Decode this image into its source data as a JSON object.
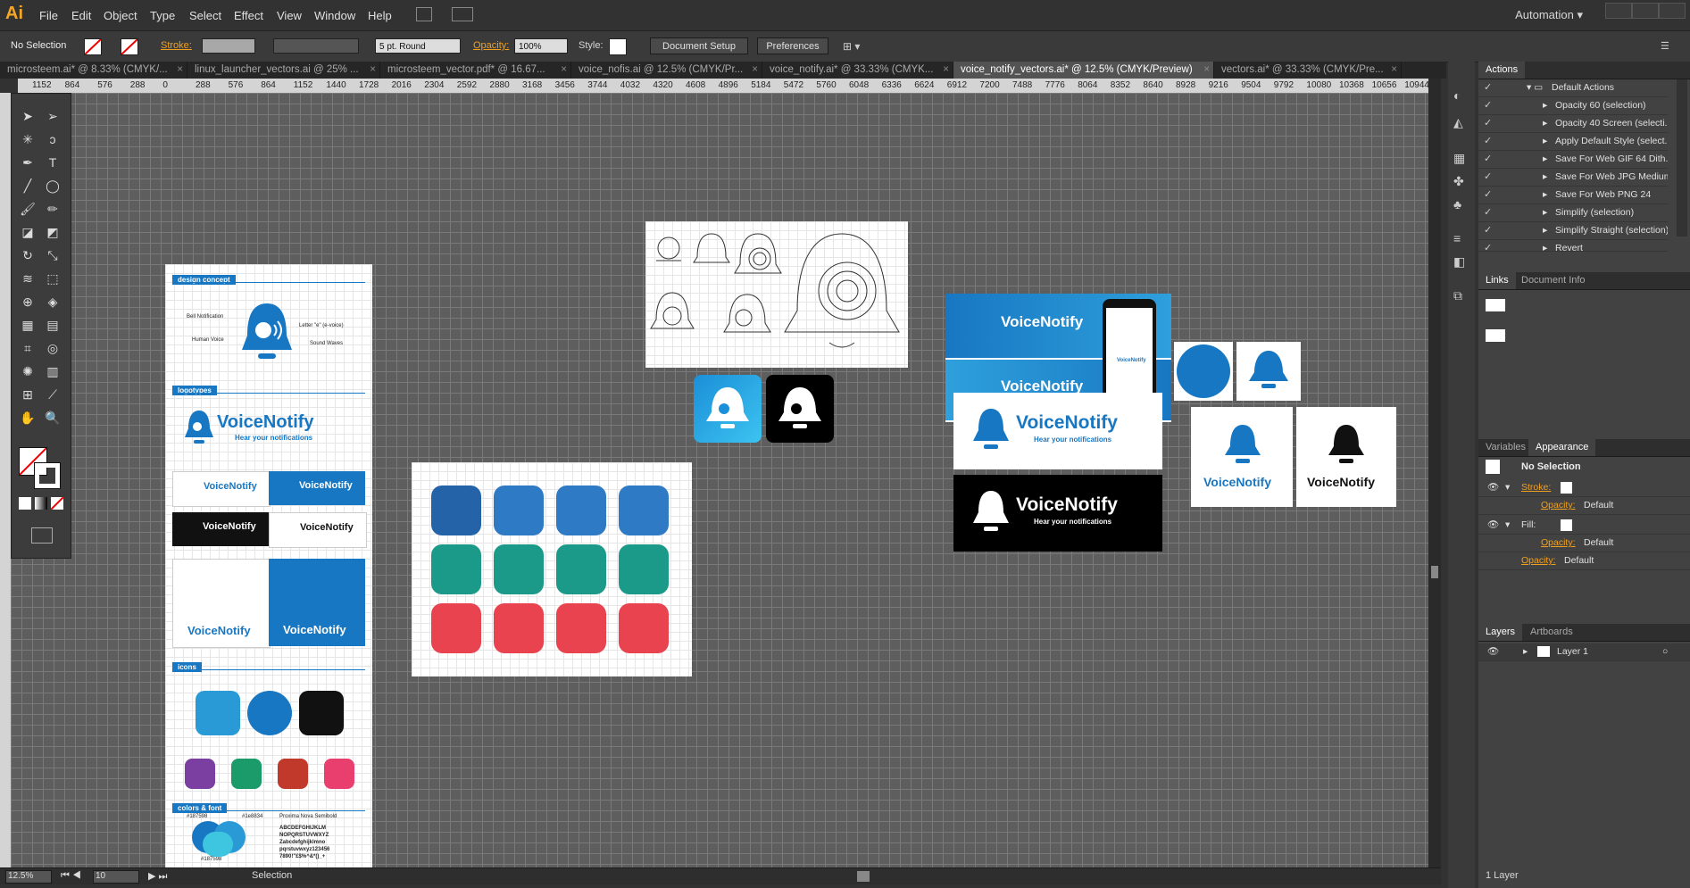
{
  "app": {
    "logo": "Ai",
    "workspace": "Automation"
  },
  "menu": [
    "File",
    "Edit",
    "Object",
    "Type",
    "Select",
    "Effect",
    "View",
    "Window",
    "Help"
  ],
  "control": {
    "selection": "No Selection",
    "stroke_label": "Stroke:",
    "brush": "5 pt. Round",
    "opacity_label": "Opacity:",
    "opacity_value": "100%",
    "style_label": "Style:",
    "doc_setup": "Document Setup",
    "preferences": "Preferences"
  },
  "tabs": [
    {
      "label": "microsteem.ai* @ 8.33% (CMYK/..."
    },
    {
      "label": "linux_launcher_vectors.ai @ 25% ..."
    },
    {
      "label": "microsteem_vector.pdf* @ 16.67..."
    },
    {
      "label": "voice_nofis.ai @ 12.5% (CMYK/Pr..."
    },
    {
      "label": "voice_notify.ai* @ 33.33% (CMYK..."
    },
    {
      "label": "voice_notify_vectors.ai* @ 12.5% (CMYK/Preview)"
    },
    {
      "label": "vectors.ai* @ 33.33% (CMYK/Pre..."
    }
  ],
  "ruler": [
    "1152",
    "864",
    "576",
    "288",
    "0",
    "288",
    "576",
    "864",
    "1152",
    "1440",
    "1728",
    "2016",
    "2304",
    "2592",
    "2880",
    "3168",
    "3456",
    "3744",
    "4032",
    "4320",
    "4608",
    "4896",
    "5184",
    "5472",
    "5760",
    "6048",
    "6336",
    "6624",
    "6912",
    "7200",
    "7488",
    "7776",
    "8064",
    "8352",
    "8640",
    "8928",
    "9216",
    "9504",
    "9792",
    "10080",
    "10368",
    "10656",
    "10944"
  ],
  "artboard": {
    "sections": [
      "design concept",
      "logotypes",
      "icons",
      "colors & font"
    ],
    "concept_labels": [
      "Bell Notification",
      "Letter \"e\" (e-voice)",
      "Human Voice",
      "Sound Waves"
    ],
    "brand": "VoiceNotify",
    "tagline": "Hear your notifications",
    "hex1": "#187598",
    "hex2": "#1e8834",
    "hex3": "#187598",
    "font_name": "Proxima Nova Semibold",
    "font_sample": [
      "ABCDEFGHIJKLM",
      "NOPQRSTUVWXYZ",
      "Zabcdefghijklmno",
      "pqrstuvwxyz123456",
      "7890!\"£$%^&*()_+"
    ]
  },
  "phone_text": "VoiceNotify",
  "actions": {
    "title": "Actions",
    "items": [
      "Default Actions",
      "Opacity 60 (selection)",
      "Opacity 40 Screen (selecti...",
      "Apply Default Style (select...",
      "Save For Web GIF 64 Dith...",
      "Save For Web JPG Medium",
      "Save For Web PNG 24",
      "Simplify (selection)",
      "Simplify Straight (selection)",
      "Revert"
    ]
  },
  "links": {
    "tabs": [
      "Links",
      "Document Info"
    ]
  },
  "appearance": {
    "tabs": [
      "Variables",
      "Appearance"
    ],
    "title": "No Selection",
    "rows": [
      "Stroke:",
      "Opacity:",
      "Default",
      "Fill:",
      "Opacity:",
      "Default",
      "Opacity:",
      "Default"
    ]
  },
  "layers": {
    "tabs": [
      "Layers",
      "Artboards"
    ],
    "layer": "Layer 1",
    "count": "1 Layer"
  },
  "status": {
    "zoom": "12.5%",
    "artboard_num": "10",
    "tool": "Selection"
  },
  "colors": {
    "brand_blue": "#1877c2",
    "teal": "#1b9a8a",
    "red": "#e8434f",
    "purple": "#7a3fa0"
  }
}
